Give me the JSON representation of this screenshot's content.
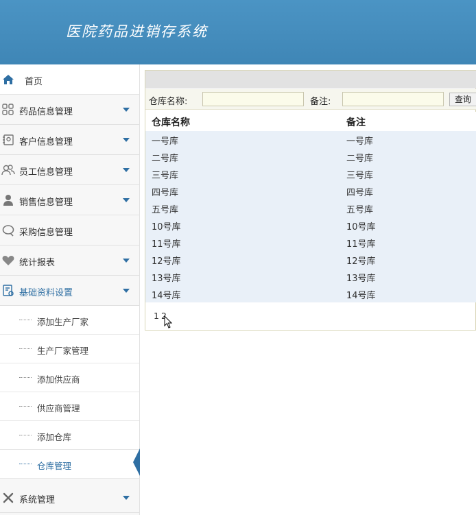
{
  "header": {
    "title": "医院药品进销存系统"
  },
  "sidebar": {
    "home": {
      "label": "首页",
      "icon": "home-icon"
    },
    "menus": [
      {
        "label": "药品信息管理",
        "icon": "grid-icon"
      },
      {
        "label": "客户信息管理",
        "icon": "contact-card-icon"
      },
      {
        "label": "员工信息管理",
        "icon": "users-icon"
      },
      {
        "label": "销售信息管理",
        "icon": "person-icon"
      },
      {
        "label": "采购信息管理",
        "icon": "chat-icon"
      },
      {
        "label": "统计报表",
        "icon": "heart-icon"
      },
      {
        "label": "基础资料设置",
        "icon": "settings-doc-icon"
      }
    ],
    "submenu": [
      {
        "label": "添加生产厂家"
      },
      {
        "label": "生产厂家管理"
      },
      {
        "label": "添加供应商"
      },
      {
        "label": "供应商管理"
      },
      {
        "label": "添加仓库"
      },
      {
        "label": "仓库管理"
      }
    ],
    "system": {
      "label": "系统管理",
      "icon": "tools-icon"
    }
  },
  "search": {
    "name_label": "仓库名称:",
    "name_value": "",
    "remark_label": "备注:",
    "remark_value": "",
    "button_label": "查询"
  },
  "table": {
    "headers": [
      "仓库名称",
      "备注"
    ],
    "rows": [
      [
        "一号库",
        "一号库"
      ],
      [
        "二号库",
        "二号库"
      ],
      [
        "三号库",
        "三号库"
      ],
      [
        "四号库",
        "四号库"
      ],
      [
        "五号库",
        "五号库"
      ],
      [
        "10号库",
        "10号库"
      ],
      [
        "11号库",
        "11号库"
      ],
      [
        "12号库",
        "12号库"
      ],
      [
        "13号库",
        "13号库"
      ],
      [
        "14号库",
        "14号库"
      ]
    ]
  },
  "pager": {
    "pages": [
      "1",
      "2"
    ]
  },
  "colors": {
    "header": "#4a90c0",
    "accent": "#2f6fa3",
    "table_bg": "#e9f0f8"
  }
}
